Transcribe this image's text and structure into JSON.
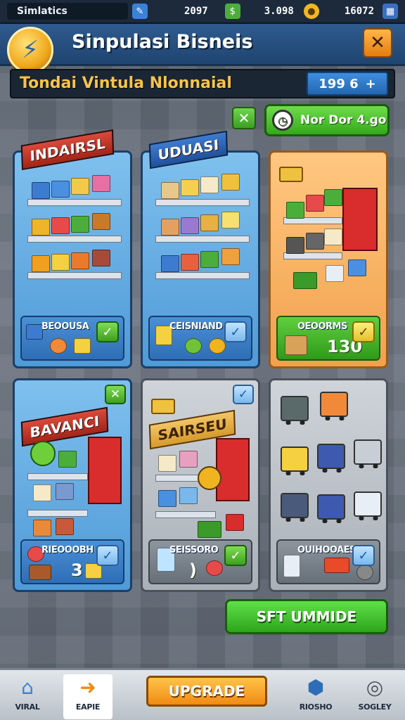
{
  "status_bar": {
    "title": "Simlatics",
    "stat_1": "2097",
    "stat_2": "3.098",
    "stat_3": "16072"
  },
  "header": {
    "app_title": "Sinpulasi Bisneis",
    "close_label": "✕"
  },
  "subheader": {
    "title": "Tondai Vintula Nlonnaial",
    "money_value": "199 6",
    "money_plus": "+"
  },
  "top_controls": {
    "toggle_check": "✕",
    "green_button_label": "Nor Dor 4.go"
  },
  "cards": [
    {
      "banner": "INDAIRSL",
      "footer_label": "BEOOUSA",
      "footer_value": "",
      "check": "✓"
    },
    {
      "banner": "UDUASI",
      "footer_label": "CEISNIAND",
      "footer_value": "",
      "check": "✓"
    },
    {
      "banner": "",
      "footer_label": "OEOORMS",
      "footer_value": "130",
      "check": "✓"
    },
    {
      "banner": "BAVANCI",
      "footer_label": "RIEOOOBH",
      "footer_value": "3",
      "check": "✓",
      "corner": "✕"
    },
    {
      "banner": "SAIRSEU",
      "footer_label": "SEISSORO",
      "footer_value": ")",
      "check": "✓",
      "corner": "✓"
    },
    {
      "banner": "",
      "footer_label": "OUIHOOAES",
      "footer_value": "",
      "check": "✓"
    }
  ],
  "action_button": {
    "label": "SFT UMMIDE"
  },
  "bottom_nav": {
    "items": [
      {
        "label": "VIRAL",
        "icon": "home-icon"
      },
      {
        "label": "EAPIE",
        "icon": "arrow-right-icon"
      },
      {
        "label": "RIOSHO",
        "icon": "cube-icon"
      },
      {
        "label": "SOGLEY",
        "icon": "settings-icon"
      }
    ],
    "upgrade_label": "UPGRADE"
  },
  "colors": {
    "header_blue": "#2f5b8f",
    "accent_green": "#34a81d",
    "accent_orange": "#f08b12",
    "money_blue": "#2366b0"
  }
}
